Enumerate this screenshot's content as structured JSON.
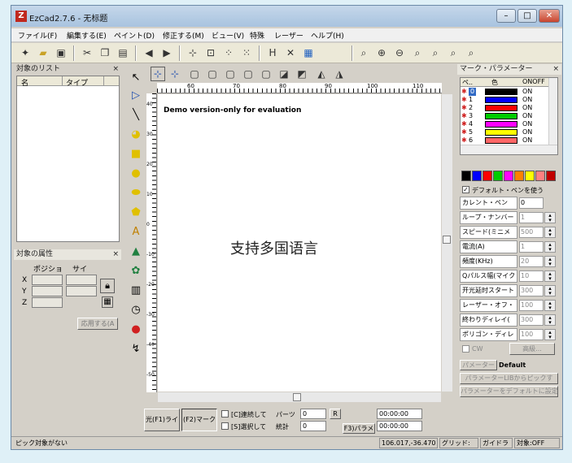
{
  "window": {
    "title": "EzCad2.7.6 - 无标题",
    "app_icon": "Z",
    "controls": {
      "minimize": "–",
      "maximize": "□",
      "close": "✕"
    }
  },
  "menu": [
    "ファイル(F)",
    "編集する(E)",
    "ペイント(D)",
    "修正する(M)",
    "ビュー(V)",
    "特殊",
    "レーザー",
    "ヘルプ(H)"
  ],
  "object_list": {
    "title": "対象のリスト",
    "col_name": "名",
    "col_type": "タイプ"
  },
  "object_props": {
    "title": "対象の属性",
    "col_pos": "ポジショ",
    "col_size": "サイ",
    "x": "X",
    "y": "Y",
    "z": "Z",
    "apply": "応用する(A"
  },
  "canvas": {
    "watermark": "Demo version-only for evaluation",
    "overlay": "支持多国语言",
    "ruler_h": [
      "60",
      "70",
      "80",
      "90",
      "100",
      "110"
    ],
    "ruler_v": [
      "40",
      "30",
      "20",
      "10",
      "0",
      "-10",
      "-20",
      "-30",
      "-40",
      "-50"
    ]
  },
  "bottom": {
    "f1": "光(F1)ライ",
    "f2": "(F2)マーク",
    "continuous": "[C]連続して",
    "parts_label": "パーツ",
    "parts_val": "0",
    "selected": "[S]選択して",
    "count_label": "統計",
    "count_val": "0",
    "r": "R",
    "f3": "F3)パラメ",
    "time1": "00:00:00",
    "time2": "00:00:00"
  },
  "params": {
    "title": "マーク・パラメーター",
    "col_pen": "ペ..",
    "col_color": "色",
    "col_onoff": "ONOFF",
    "pens": [
      {
        "n": "0",
        "c": "#000000",
        "s": "ON"
      },
      {
        "n": "1",
        "c": "#0000ff",
        "s": "ON"
      },
      {
        "n": "2",
        "c": "#ff0000",
        "s": "ON"
      },
      {
        "n": "3",
        "c": "#00cc00",
        "s": "ON"
      },
      {
        "n": "4",
        "c": "#ff00ff",
        "s": "ON"
      },
      {
        "n": "5",
        "c": "#ffff00",
        "s": "ON"
      },
      {
        "n": "6",
        "c": "#ff6666",
        "s": "ON"
      }
    ],
    "palette": [
      "#000000",
      "#0000ff",
      "#ff0000",
      "#00cc00",
      "#ff00ff",
      "#ff8000",
      "#ffff00",
      "#ff8080",
      "#c00000"
    ],
    "default_pen": "デフォルト・ペンを使う",
    "rows": [
      {
        "label": "カレント・ペン",
        "val": "0"
      },
      {
        "label": "ループ・ナンバー",
        "val": "1"
      },
      {
        "label": "スピード(ミニメ",
        "val": "500"
      },
      {
        "label": "電流(A)",
        "val": "1"
      },
      {
        "label": "頻度(KHz)",
        "val": "20"
      },
      {
        "label": "Qパルス幅(マイク",
        "val": "10"
      },
      {
        "label": "开光延时スタート",
        "val": "300"
      },
      {
        "label": "レーザー・オフ・",
        "val": "100"
      },
      {
        "label": "終わりディレイ(",
        "val": "300"
      },
      {
        "label": "ポリゴン・ディレ",
        "val": "100"
      }
    ],
    "cw": "CW",
    "advanced": "高級...",
    "param_label": "パメーター",
    "param_val": "Default",
    "pick_lib": "パラメーターLIBからピックす",
    "set_default": "パラメーターをデフォルトに設定す"
  },
  "status": {
    "message": "ピック対象がない",
    "coords": "106.017,-36.470",
    "grid": "グリッド:",
    "guide": "ガイドラ",
    "object": "対象:OFF"
  }
}
